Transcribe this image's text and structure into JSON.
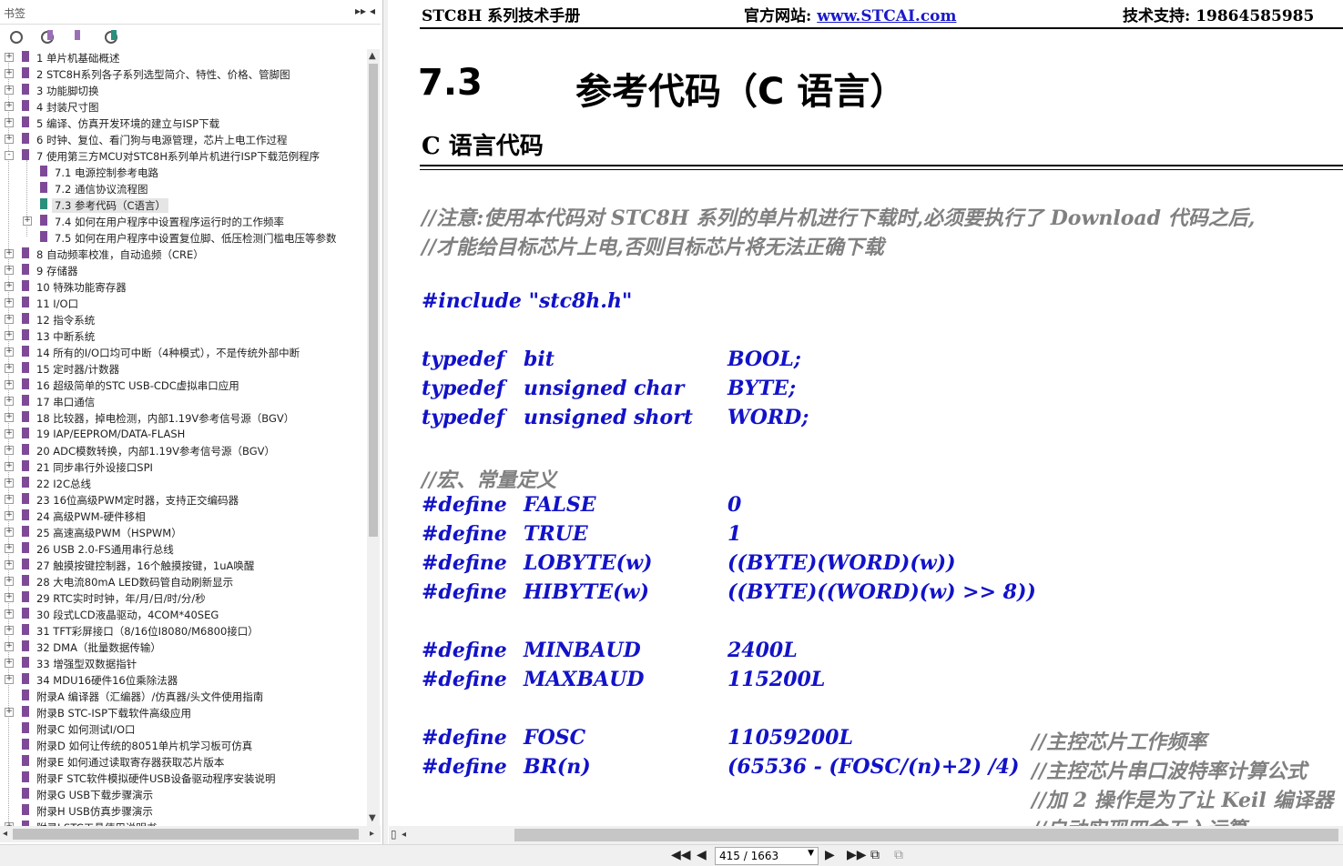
{
  "sidebar": {
    "title": "书签",
    "toc": [
      {
        "label": "1 单片机基础概述",
        "level": 0,
        "expand": "+"
      },
      {
        "label": "2  STC8H系列各子系列选型简介、特性、价格、管脚图",
        "level": 0,
        "expand": "+"
      },
      {
        "label": "3  功能脚切换",
        "level": 0,
        "expand": "+"
      },
      {
        "label": "4  封装尺寸图",
        "level": 0,
        "expand": "+"
      },
      {
        "label": "5  编译、仿真开发环境的建立与ISP下载",
        "level": 0,
        "expand": "+"
      },
      {
        "label": "6  时钟、复位、看门狗与电源管理，芯片上电工作过程",
        "level": 0,
        "expand": "+"
      },
      {
        "label": "7  使用第三方MCU对STC8H系列单片机进行ISP下载范例程序",
        "level": 0,
        "expand": "-"
      },
      {
        "label": "7.1 电源控制参考电路",
        "level": 1,
        "expand": ""
      },
      {
        "label": "7.2  通信协议流程图",
        "level": 1,
        "expand": ""
      },
      {
        "label": "7.3  参考代码（C语言）",
        "level": 1,
        "expand": "",
        "selected": true
      },
      {
        "label": "7.4  如何在用户程序中设置程序运行时的工作频率",
        "level": 1,
        "expand": "+"
      },
      {
        "label": "7.5 如何在用户程序中设置复位脚、低压检测门槛电压等参数",
        "level": 1,
        "expand": ""
      },
      {
        "label": "8  自动频率校准，自动追频（CRE）",
        "level": 0,
        "expand": "+"
      },
      {
        "label": "9  存储器",
        "level": 0,
        "expand": "+"
      },
      {
        "label": "10  特殊功能寄存器",
        "level": 0,
        "expand": "+"
      },
      {
        "label": "11  I/O口",
        "level": 0,
        "expand": "+"
      },
      {
        "label": "12  指令系统",
        "level": 0,
        "expand": "+"
      },
      {
        "label": "13  中断系统",
        "level": 0,
        "expand": "+"
      },
      {
        "label": "14  所有的I/O口均可中断（4种模式），不是传统外部中断",
        "level": 0,
        "expand": "+"
      },
      {
        "label": "15  定时器/计数器",
        "level": 0,
        "expand": "+"
      },
      {
        "label": "16  超级简单的STC USB-CDC虚拟串口应用",
        "level": 0,
        "expand": "+"
      },
      {
        "label": "17  串口通信",
        "level": 0,
        "expand": "+"
      },
      {
        "label": "18  比较器，掉电检测，内部1.19V参考信号源（BGV）",
        "level": 0,
        "expand": "+"
      },
      {
        "label": "19  IAP/EEPROM/DATA-FLASH",
        "level": 0,
        "expand": "+"
      },
      {
        "label": "20  ADC模数转换，内部1.19V参考信号源（BGV）",
        "level": 0,
        "expand": "+"
      },
      {
        "label": "21  同步串行外设接口SPI",
        "level": 0,
        "expand": "+"
      },
      {
        "label": "22  I2C总线",
        "level": 0,
        "expand": "+"
      },
      {
        "label": "23  16位高级PWM定时器，支持正交编码器",
        "level": 0,
        "expand": "+"
      },
      {
        "label": "24  高级PWM-硬件移相",
        "level": 0,
        "expand": "+"
      },
      {
        "label": "25  高速高级PWM（HSPWM）",
        "level": 0,
        "expand": "+"
      },
      {
        "label": "26  USB 2.0-FS通用串行总线",
        "level": 0,
        "expand": "+"
      },
      {
        "label": "27  触摸按键控制器，16个触摸按键，1uA唤醒",
        "level": 0,
        "expand": "+"
      },
      {
        "label": "28  大电流80mA  LED数码管自动刷新显示",
        "level": 0,
        "expand": "+"
      },
      {
        "label": "29  RTC实时时钟，年/月/日/时/分/秒",
        "level": 0,
        "expand": "+"
      },
      {
        "label": "30  段式LCD液晶驱动，4COM*40SEG",
        "level": 0,
        "expand": "+"
      },
      {
        "label": "31  TFT彩屏接口（8/16位I8080/M6800接口）",
        "level": 0,
        "expand": "+"
      },
      {
        "label": "32  DMA（批量数据传输）",
        "level": 0,
        "expand": "+"
      },
      {
        "label": "33  增强型双数据指针",
        "level": 0,
        "expand": "+"
      },
      {
        "label": "34  MDU16硬件16位乘除法器",
        "level": 0,
        "expand": "+"
      },
      {
        "label": "附录A  编译器（汇编器）/仿真器/头文件使用指南",
        "level": 0,
        "expand": ""
      },
      {
        "label": "附录B  STC-ISP下载软件高级应用",
        "level": 0,
        "expand": "+"
      },
      {
        "label": "附录C  如何测试I/O口",
        "level": 0,
        "expand": ""
      },
      {
        "label": "附录D  如何让传统的8051单片机学习板可仿真",
        "level": 0,
        "expand": ""
      },
      {
        "label": "附录E  如何通过读取寄存器获取芯片版本",
        "level": 0,
        "expand": ""
      },
      {
        "label": "附录F  STC软件模拟硬件USB设备驱动程序安装说明",
        "level": 0,
        "expand": ""
      },
      {
        "label": "附录G  USB下载步骤演示",
        "level": 0,
        "expand": ""
      },
      {
        "label": "附录H  USB仿真步骤演示",
        "level": 0,
        "expand": ""
      },
      {
        "label": "附录I  STC工具使用说明书",
        "level": 0,
        "expand": "+"
      }
    ]
  },
  "document": {
    "header": {
      "left": "STC8H 系列技术手册",
      "site_label": "官方网站: ",
      "site_url": "www.STCAI.com",
      "support": "技术支持: 19864585985"
    },
    "section_number": "7.3",
    "section_title": "参考代码（C 语言）",
    "subtitle": "C 语言代码",
    "comment1": "//注意:使用本代码对 STC8H 系列的单片机进行下载时,必须要执行了 Download 代码之后,",
    "comment2": "//才能给目标芯片上电,否则目标芯片将无法正确下载",
    "include": "#include \"stc8h.h\"",
    "typedefs": [
      {
        "kw": "typedef",
        "type": "bit",
        "name": "BOOL;"
      },
      {
        "kw": "typedef",
        "type": "unsigned char",
        "name": "BYTE;"
      },
      {
        "kw": "typedef",
        "type": "unsigned short",
        "name": "WORD;"
      }
    ],
    "macro_comment": "//宏、常量定义",
    "defines1": [
      {
        "kw": "#define",
        "name": "FALSE",
        "value": "0"
      },
      {
        "kw": "#define",
        "name": "TRUE",
        "value": "1"
      },
      {
        "kw": "#define",
        "name": "LOBYTE(w)",
        "value": "((BYTE)(WORD)(w))"
      },
      {
        "kw": "#define",
        "name": "HIBYTE(w)",
        "value": "((BYTE)((WORD)(w) >> 8))"
      }
    ],
    "defines2": [
      {
        "kw": "#define",
        "name": "MINBAUD",
        "value": "2400L"
      },
      {
        "kw": "#define",
        "name": "MAXBAUD",
        "value": "115200L"
      }
    ],
    "defines3": [
      {
        "kw": "#define",
        "name": "FOSC",
        "value": "11059200L",
        "comment": "//主控芯片工作频率"
      },
      {
        "kw": "#define",
        "name": "BR(n)",
        "value": "(65536 - (FOSC/(n)+2) /4)",
        "comment": "//主控芯片串口波特率计算公式"
      }
    ],
    "trailing_comment1": "//加 2 操作是为了让 Keil 编译器",
    "trailing_comment2": "//自动实现四舍五入运算"
  },
  "toolbar": {
    "page_indicator": "415 / 1663"
  },
  "colors": {
    "code": "#1212c8",
    "comment": "#808080",
    "bookmark": "#7e4a97",
    "bookmark_active": "#2a8f7c"
  }
}
